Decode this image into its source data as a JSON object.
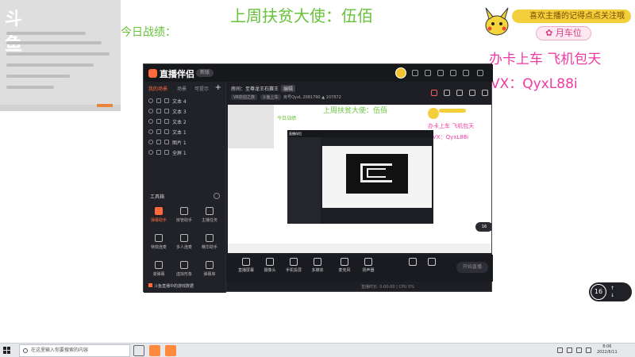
{
  "overlay": {
    "week_title": "上周扶贫大使：伍佰",
    "today_record": "今日战绩：",
    "fan_banner": "喜欢主播的记得点点关注哦",
    "monthly": "月车位",
    "card_board": "办卡上车   飞机包天",
    "vx": "VX：QyxL88i",
    "chat_logo": "斗鱼"
  },
  "app": {
    "logo": "直播伴侣",
    "version": "新版",
    "scene_tabs": [
      "我的场景",
      "场景",
      "可提示"
    ],
    "scene_add": "+",
    "layers": [
      "文本 4",
      "文本 3",
      "文本 2",
      "文本 1",
      "图片 1",
      "全屏 1"
    ],
    "tools_title": "工具箱",
    "tools": [
      "弹幕助手",
      "房管助手",
      "主播任务",
      "特效连麦",
      "多人连麦",
      "精华助手",
      "滚弹幕",
      "虚拟形象",
      "弹幕库"
    ],
    "footer": "斗鱼直播中的游戏数据",
    "room": {
      "label": "房间：",
      "title": "至尊龙王石赛王",
      "edit": "编辑",
      "uid": "房号QyxL",
      "fans": "2081790",
      "hot": "107872",
      "pill1": "VR欢迎之旅",
      "pill2": "斗鱼上车"
    },
    "preview": {
      "title": "上周扶贫大使：伍佰",
      "today": "今日战绩",
      "card": "办卡上车   飞机包天",
      "vx": "VX：QyxL88i",
      "badge": "16"
    },
    "bottom_tools": [
      "直播屏幕",
      "摄像头",
      "手机投屏",
      "多媒体",
      "麦克风",
      "扬声器"
    ],
    "live_button": "开始直播",
    "status": "直播时长: 0:00:00 | CPU 0%"
  },
  "float_badge": {
    "num": "16",
    "line1": "",
    "line2": ""
  },
  "taskbar": {
    "search_placeholder": "在这里输入你要搜索的内容",
    "time": "8:06",
    "date": "2022/6/11"
  }
}
